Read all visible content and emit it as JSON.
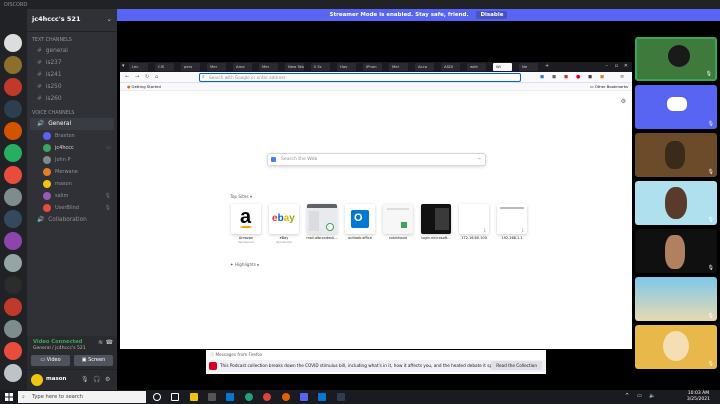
{
  "app_title": "DISCORD",
  "server": {
    "name": "jc4hccc's 521"
  },
  "channels": {
    "text_category": "TEXT CHANNELS",
    "text": [
      "general",
      "is237",
      "is241",
      "is250",
      "is260"
    ],
    "voice_category": "VOICE CHANNELS",
    "voice_active": "General",
    "voice_users": [
      "Braxton",
      "jc4hccc",
      "John P",
      "Merwane",
      "mason",
      "salim",
      "UserBlind"
    ],
    "voice_other": "Collaboration"
  },
  "voice_status": {
    "connected": "Video Connected",
    "channel": "General / jc4hccc's 521",
    "video_label": "Video",
    "screen_label": "Screen"
  },
  "user": {
    "name": "mason"
  },
  "streamer_banner": {
    "text": "Streamer Mode is enabled. Stay safe, friend.",
    "button": "Disable"
  },
  "browser": {
    "tabs": [
      "Lec",
      "CIS",
      "pers",
      "Mer",
      "Ama",
      "Mer",
      "New Tab",
      "Il Sc",
      "Hav",
      "iPhon",
      "Mer",
      "Acco",
      "ASDI",
      "wikt",
      "Wi",
      "Ne"
    ],
    "url_placeholder": "Search with Google or enter address",
    "bookmark_getting_started": "Getting Started",
    "bookmark_other": "Other Bookmarks",
    "search_placeholder": "Search the Web",
    "top_sites_label": "Top Sites",
    "sites": [
      {
        "label": "Amazon",
        "sub": "Sponsored"
      },
      {
        "label": "eBay",
        "sub": "Sponsored"
      },
      {
        "label": "mail.albrondeck...",
        "sub": ""
      },
      {
        "label": "outlook.office",
        "sub": ""
      },
      {
        "label": "robinhood",
        "sub": ""
      },
      {
        "label": "login.microsoft...",
        "sub": ""
      },
      {
        "label": "172.16.60.100",
        "sub": ""
      },
      {
        "label": "192.168.1.1",
        "sub": ""
      }
    ],
    "highlights_label": "Highlights",
    "snippet_header": "Messages from Firefox",
    "snippet_body": "This Podcast collection breaks down the COVID stimulus bill, including what's in it, how it affects you, and the heated debate it sparked.",
    "snippet_button": "Read the Collection"
  },
  "taskbar": {
    "search_placeholder": "Type here to search",
    "time": "10:03 AM",
    "date": "3/25/2021"
  },
  "colors": {
    "blurple": "#5865f2",
    "discord_bg": "#2f3136",
    "online": "#3ba55d"
  }
}
